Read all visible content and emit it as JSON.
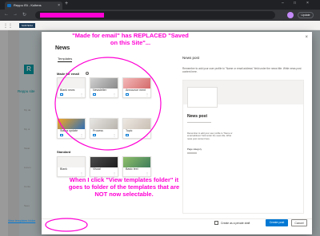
{
  "browser": {
    "tab_title": "Reppu ISt - Koltens",
    "update_label": "Update",
    "colors": {
      "redaction": "#ff00d4",
      "chrome": "#202124"
    }
  },
  "suite": {
    "brand": "SANTENA"
  },
  "site": {
    "logo_letter": "R",
    "name": "Reppu site",
    "nav": [
      "My da",
      "My ot",
      "Tavat",
      "Lorem",
      "Conte",
      "Sees"
    ]
  },
  "modal": {
    "title": "News",
    "tab": "Templates",
    "sections": {
      "made_for_email": {
        "label": "Made for email",
        "templates": [
          "Blank news",
          "Newsletter",
          "Announce ment",
          "Status update",
          "Process",
          "Topic"
        ]
      },
      "standard": {
        "label": "Standard",
        "templates": [
          "Blank",
          "Visual",
          "Basic text"
        ]
      }
    },
    "preview": {
      "title": "News post",
      "description": "Remember to add your user profile to \"Name or email address\" field under the news title. Write news post content here.",
      "heading": "News post",
      "body": "Remember to add your user profile to \"Name or email address\" field under the news title. Write news post content here.",
      "label": "Page category"
    },
    "footer": {
      "view_templates_link": "View templates folder",
      "private_draft_label": "Create as a private draft",
      "create_button": "Create post",
      "cancel_button": "Cancel"
    }
  },
  "annotations": {
    "top_note": "\"Made for email\" has REPLACED \"Saved on this Site\"...",
    "bottom_note": "When I click \"View templates folder\" it goes to folder of the templates that are NOT now selectable.",
    "color": "#ff00d4"
  }
}
